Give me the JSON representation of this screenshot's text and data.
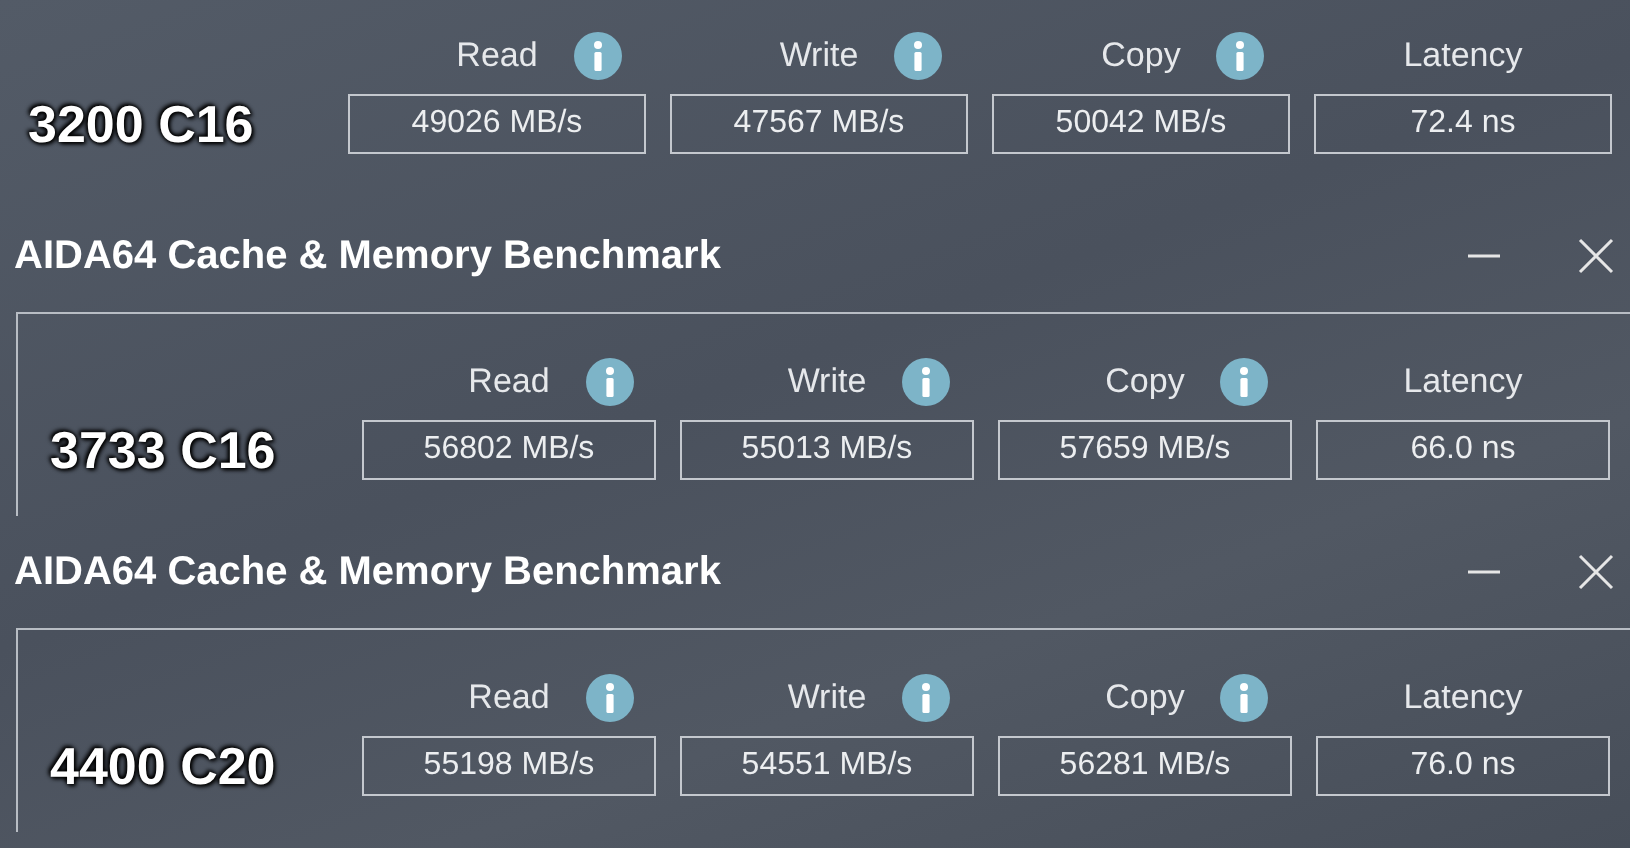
{
  "benchmarks": [
    {
      "label": "3200 C16",
      "columns": [
        {
          "header": "Read",
          "value": "49026 MB/s",
          "info": true
        },
        {
          "header": "Write",
          "value": "47567 MB/s",
          "info": true
        },
        {
          "header": "Copy",
          "value": "50042 MB/s",
          "info": true
        },
        {
          "header": "Latency",
          "value": "72.4 ns",
          "info": false
        }
      ]
    },
    {
      "window_title": "AIDA64 Cache & Memory Benchmark",
      "label": "3733 C16",
      "columns": [
        {
          "header": "Read",
          "value": "56802 MB/s",
          "info": true
        },
        {
          "header": "Write",
          "value": "55013 MB/s",
          "info": true
        },
        {
          "header": "Copy",
          "value": "57659 MB/s",
          "info": true
        },
        {
          "header": "Latency",
          "value": "66.0 ns",
          "info": false
        }
      ]
    },
    {
      "window_title": "AIDA64 Cache & Memory Benchmark",
      "label": "4400 C20",
      "columns": [
        {
          "header": "Read",
          "value": "55198 MB/s",
          "info": true
        },
        {
          "header": "Write",
          "value": "54551 MB/s",
          "info": true
        },
        {
          "header": "Copy",
          "value": "56281 MB/s",
          "info": true
        },
        {
          "header": "Latency",
          "value": "76.0 ns",
          "info": false
        }
      ]
    }
  ]
}
